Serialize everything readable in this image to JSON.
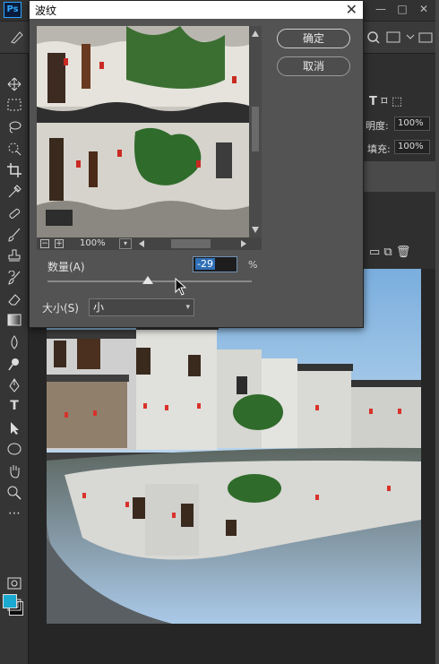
{
  "app": {
    "logo": "Ps",
    "minimize": "—",
    "restore": "□",
    "close": "✕"
  },
  "dialog": {
    "title": "波纹",
    "close_icon": "✕",
    "ok_label": "确定",
    "cancel_label": "取消",
    "zoom_minus": "−",
    "zoom_plus": "+",
    "zoom_level": "100%",
    "amount_label": "数量(A)",
    "amount_value": "-29",
    "amount_unit": "%",
    "amount_slider_fraction": 0.49,
    "size_label": "大小(S)",
    "size_value": "小"
  },
  "layers_panel": {
    "opacity_label": "明度:",
    "opacity_value": "100%",
    "fill_label": "填充:",
    "fill_value": "100%"
  },
  "colors": {
    "foreground": "#1aa9d1",
    "background": "#0a0a0a",
    "accent": "#31a8ff"
  },
  "icons": [
    "move-tool-icon",
    "marquee-tool-icon",
    "lasso-tool-icon",
    "quick-select-tool-icon",
    "crop-tool-icon",
    "eyedropper-tool-icon",
    "healing-tool-icon",
    "brush-tool-icon",
    "stamp-tool-icon",
    "history-brush-icon",
    "eraser-tool-icon",
    "gradient-tool-icon",
    "blur-tool-icon",
    "dodge-tool-icon",
    "pen-tool-icon",
    "type-tool-icon",
    "path-select-tool-icon",
    "ellipse-tool-icon",
    "hand-tool-icon",
    "zoom-tool-icon"
  ]
}
